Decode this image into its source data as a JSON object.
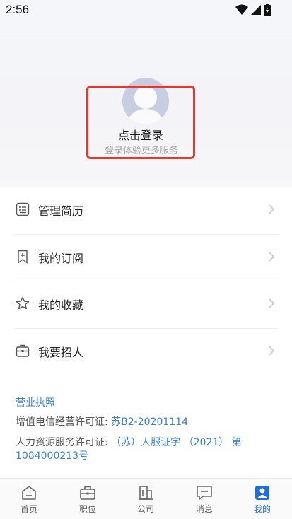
{
  "status_bar": {
    "time": "2:56"
  },
  "login": {
    "title": "点击登录",
    "subtitle": "登录体验更多服务"
  },
  "menu": [
    {
      "label": "管理简历",
      "icon": "resume-icon"
    },
    {
      "label": "我的订阅",
      "icon": "subscribe-icon"
    },
    {
      "label": "我的收藏",
      "icon": "star-icon"
    },
    {
      "label": "我要招人",
      "icon": "briefcase-icon"
    }
  ],
  "footer": {
    "license_link": "营业执照",
    "telecom_label": "增值电信经营许可证: ",
    "telecom_value": "苏B2-20201114",
    "hr_label": "人力资源服务许可证: ",
    "hr_value": "（苏）人服证字 （2021） 第1084000213号"
  },
  "tabs": [
    {
      "label": "首页",
      "icon": "home-icon",
      "active": false
    },
    {
      "label": "职位",
      "icon": "briefcase-icon",
      "active": false
    },
    {
      "label": "公司",
      "icon": "building-icon",
      "active": false
    },
    {
      "label": "消息",
      "icon": "message-icon",
      "active": false
    },
    {
      "label": "我的",
      "icon": "profile-icon",
      "active": true
    }
  ],
  "colors": {
    "accent": "#1d6fe0",
    "link": "#3a82d6",
    "highlight_box": "#e23b2e"
  }
}
